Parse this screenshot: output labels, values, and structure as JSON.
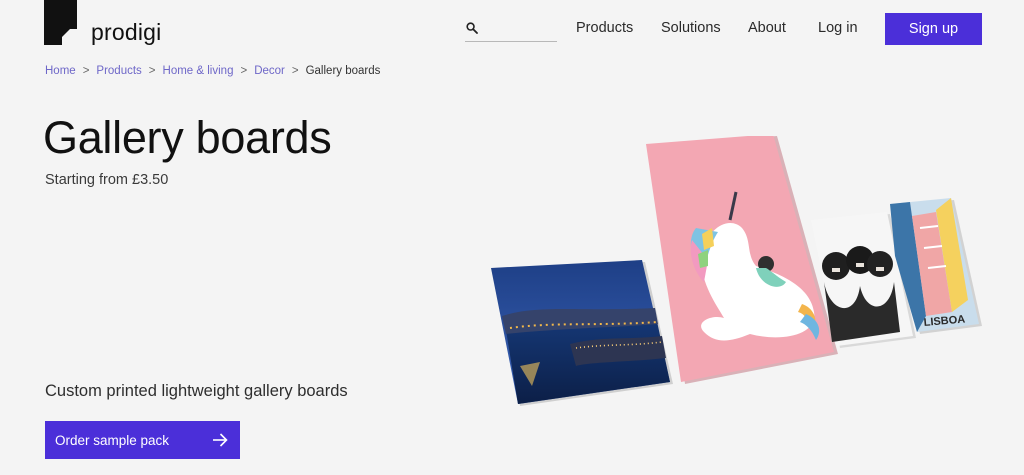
{
  "brand": {
    "name": "prodigi"
  },
  "header": {
    "search": {
      "placeholder": "",
      "icon": "search-icon"
    },
    "nav": {
      "products": "Products",
      "solutions": "Solutions",
      "about": "About",
      "login": "Log in"
    },
    "signup_label": "Sign up"
  },
  "breadcrumb": {
    "items": [
      "Home",
      "Products",
      "Home & living",
      "Decor"
    ],
    "separator": ">",
    "current": "Gallery boards"
  },
  "hero": {
    "title": "Gallery boards",
    "price": "Starting from £3.50",
    "tagline": "Custom printed lightweight gallery boards",
    "cta_label": "Order sample pack",
    "cta_icon": "arrow-right-icon",
    "image_boards": [
      "night harbour photo",
      "unicorn illustration",
      "black and white portrait",
      "Lisboa street illustration"
    ],
    "image_text": "LISBOA"
  },
  "colors": {
    "accent": "#4b2fd9",
    "link": "#6e67c8",
    "background": "#f4f4f4"
  }
}
